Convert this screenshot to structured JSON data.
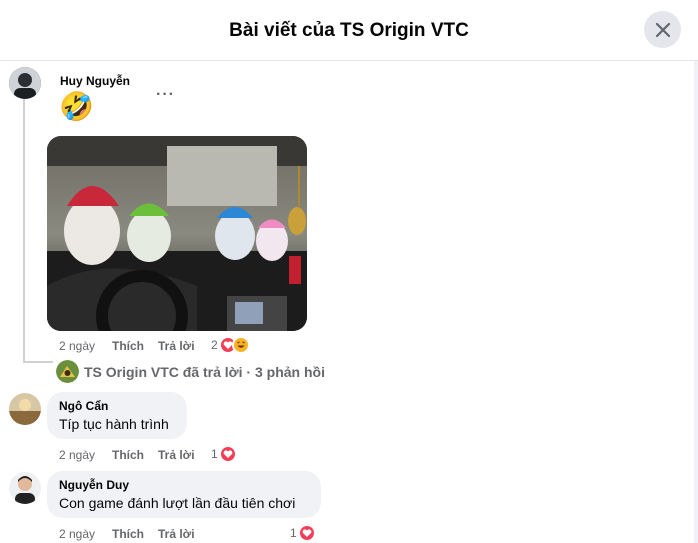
{
  "header": {
    "title": "Bài viết của TS Origin VTC"
  },
  "comments": [
    {
      "author": "Huy Nguyễn",
      "emoji": "🤣",
      "time": "2 ngày",
      "like_label": "Thích",
      "reply_label": "Trả lời",
      "reaction_count": "2",
      "reactions": [
        "heart",
        "haha"
      ]
    },
    {
      "author": "Ngô Cẩn",
      "text": "Típ tục hành trình",
      "time": "2 ngày",
      "like_label": "Thích",
      "reply_label": "Trả lời",
      "reaction_count": "1",
      "reactions": [
        "heart"
      ]
    },
    {
      "author": "Nguyễn Duy",
      "text": "Con game đánh lượt lần đầu tiên chơi",
      "time": "2 ngày",
      "like_label": "Thích",
      "reply_label": "Trả lời",
      "reaction_count": "1",
      "reactions": [
        "heart"
      ]
    }
  ],
  "replies_summary": {
    "text": "TS Origin VTC đã trả lời · 3 phản hồi"
  },
  "icons": {
    "close": "close-icon",
    "more": "more-options-icon",
    "heart": "heart-icon",
    "haha": "haha-icon"
  },
  "colors": {
    "bubble": "#f0f2f5",
    "heart": "#f33e58",
    "haha": "#f7b125",
    "muted": "#65676b"
  }
}
